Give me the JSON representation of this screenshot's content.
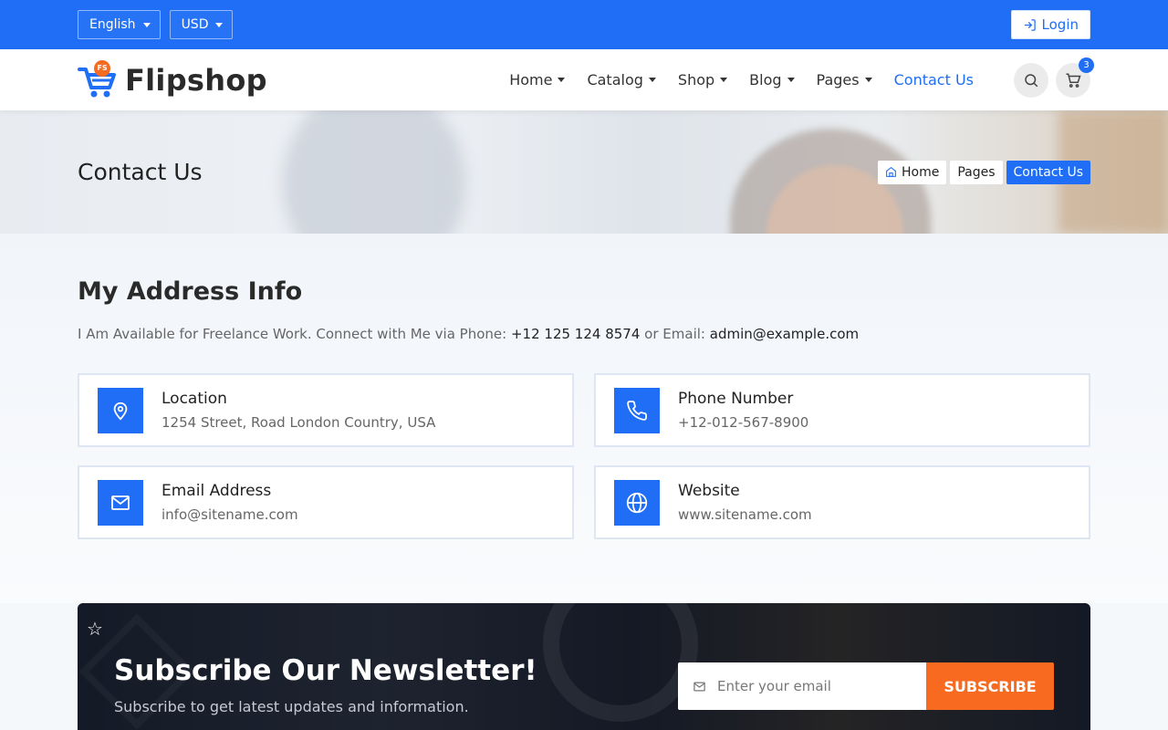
{
  "topbar": {
    "language": "English",
    "currency": "USD",
    "login_label": "Login"
  },
  "header": {
    "brand_badge": "FS",
    "brand_name": "Flipshop",
    "nav": [
      {
        "label": "Home"
      },
      {
        "label": "Catalog"
      },
      {
        "label": "Shop"
      },
      {
        "label": "Blog"
      },
      {
        "label": "Pages"
      },
      {
        "label": "Contact Us"
      }
    ],
    "cart_count": "3"
  },
  "hero": {
    "title": "Contact Us",
    "breadcrumb": [
      "Home",
      "Pages",
      "Contact Us"
    ]
  },
  "address": {
    "title": "My Address Info",
    "sub_prefix": "I Am Available for Freelance Work. Connect with Me via Phone:",
    "phone": "+12 125 124 8574",
    "sub_mid": "or Email:",
    "email": "admin@example.com",
    "cards": [
      {
        "icon": "location-pin-icon",
        "title": "Location",
        "value": "1254 Street, Road London Country, USA"
      },
      {
        "icon": "phone-icon",
        "title": "Phone Number",
        "value": "+12-012-567-8900"
      },
      {
        "icon": "mail-icon",
        "title": "Email Address",
        "value": "info@sitename.com"
      },
      {
        "icon": "globe-icon",
        "title": "Website",
        "value": "www.sitename.com"
      }
    ]
  },
  "newsletter": {
    "title": "Subscribe Our Newsletter!",
    "subtitle": "Subscribe to get latest updates and information.",
    "placeholder": "Enter your email",
    "button": "SUBSCRIBE"
  },
  "colors": {
    "primary": "#1f6ef5",
    "accent": "#f76a1f"
  }
}
